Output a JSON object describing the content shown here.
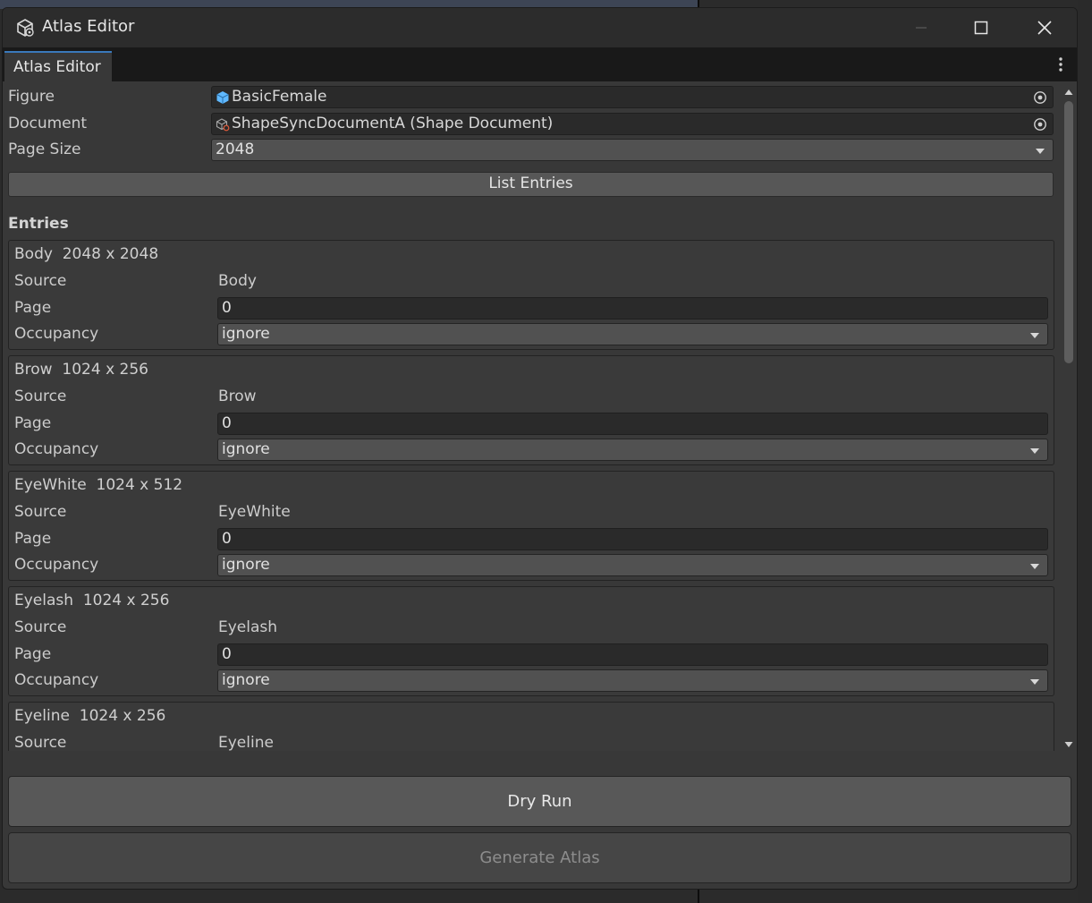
{
  "window": {
    "title": "Atlas Editor",
    "tab_label": "Atlas Editor"
  },
  "fields": {
    "figure": {
      "label": "Figure",
      "value": "BasicFemale"
    },
    "document": {
      "label": "Document",
      "value": "ShapeSyncDocumentA (Shape Document)"
    },
    "page_size": {
      "label": "Page Size",
      "value": "2048"
    }
  },
  "list_entries_label": "List Entries",
  "entries_heading": "Entries",
  "row_labels": {
    "source": "Source",
    "page": "Page",
    "occupancy": "Occupancy"
  },
  "entries": [
    {
      "name": "Body",
      "size": "2048 x 2048",
      "source": "Body",
      "page": "0",
      "occupancy": "ignore"
    },
    {
      "name": "Brow",
      "size": "1024 x 256",
      "source": "Brow",
      "page": "0",
      "occupancy": "ignore"
    },
    {
      "name": "EyeWhite",
      "size": "1024 x 512",
      "source": "EyeWhite",
      "page": "0",
      "occupancy": "ignore"
    },
    {
      "name": "Eyelash",
      "size": "1024 x 256",
      "source": "Eyelash",
      "page": "0",
      "occupancy": "ignore"
    },
    {
      "name": "Eyeline",
      "size": "1024 x 256",
      "source": "Eyeline"
    }
  ],
  "buttons": {
    "dry_run": "Dry Run",
    "generate": "Generate Atlas"
  },
  "colors": {
    "tab_accent": "#3a79bb",
    "figure_icon": "#5fb8ff",
    "disabled_text": "#8d8d8d"
  },
  "icons": {
    "app": "unity-cube-icon",
    "figure": "prefab-cube-icon",
    "document": "shape-document-icon",
    "picker": "object-picker-icon"
  }
}
